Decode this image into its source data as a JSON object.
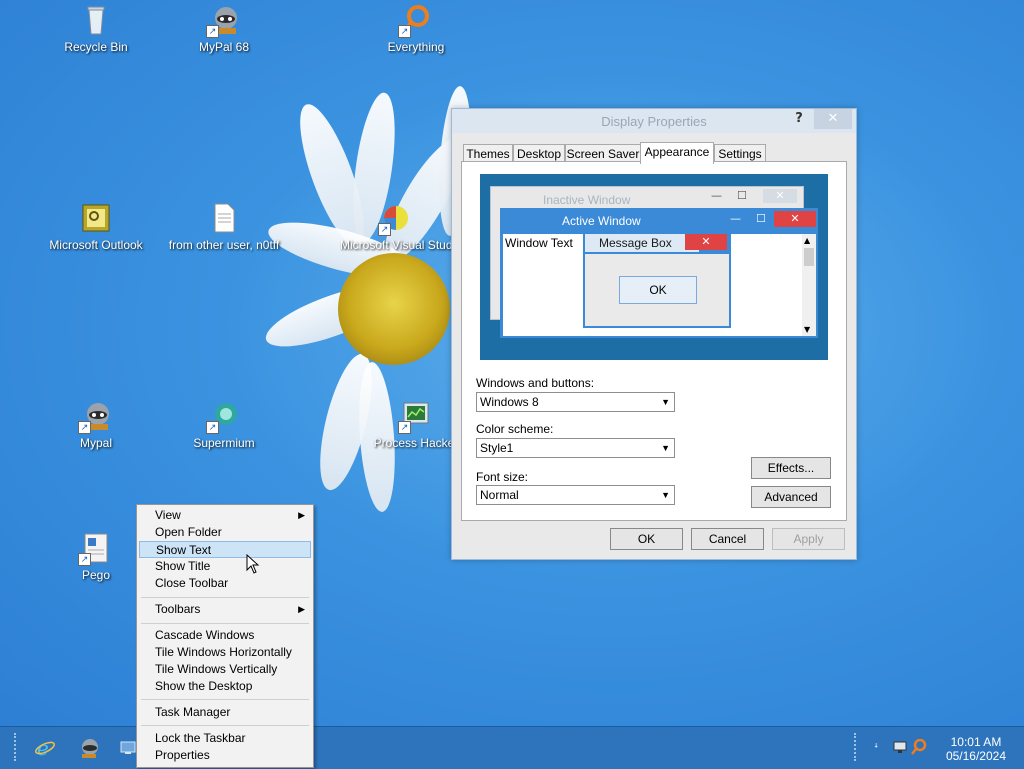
{
  "desktop": {
    "icons": [
      {
        "label": "Recycle Bin"
      },
      {
        "label": "MyPal 68"
      },
      {
        "label": "Everything"
      },
      {
        "label": "Microsoft Outlook"
      },
      {
        "label": "from other user, n0tff"
      },
      {
        "label": "Microsoft Visual Stud"
      },
      {
        "label": "Mypal"
      },
      {
        "label": "Supermium"
      },
      {
        "label": "Process Hacker"
      },
      {
        "label": "Pego"
      }
    ]
  },
  "dialog": {
    "title": "Display Properties",
    "help_label": "?",
    "close_label": "✕",
    "tabs": [
      {
        "label": "Themes"
      },
      {
        "label": "Desktop"
      },
      {
        "label": "Screen Saver"
      },
      {
        "label": "Appearance"
      },
      {
        "label": "Settings"
      }
    ],
    "preview": {
      "inactive_title": "Inactive Window",
      "active_title": "Active Window",
      "window_text": "Window Text",
      "message_title": "Message Box",
      "ok_label": "OK"
    },
    "windows_buttons": {
      "label": "Windows and buttons:",
      "value": "Windows 8"
    },
    "color_scheme": {
      "label": "Color scheme:",
      "value": "Style1"
    },
    "font_size": {
      "label": "Font size:",
      "value": "Normal"
    },
    "effects_label": "Effects...",
    "advanced_label": "Advanced",
    "ok_label": "OK",
    "cancel_label": "Cancel",
    "apply_label": "Apply"
  },
  "context_menu": {
    "items": [
      {
        "label": "View"
      },
      {
        "label": "Open Folder"
      },
      {
        "label": "Show Text"
      },
      {
        "label": "Show Title"
      },
      {
        "label": "Close Toolbar"
      },
      {
        "label": "Toolbars"
      },
      {
        "label": "Cascade Windows"
      },
      {
        "label": "Tile Windows Horizontally"
      },
      {
        "label": "Tile Windows Vertically"
      },
      {
        "label": "Show the Desktop"
      },
      {
        "label": "Task Manager"
      },
      {
        "label": "Lock the Taskbar"
      },
      {
        "label": "Properties"
      }
    ]
  },
  "taskbar": {
    "time": "10:01 AM",
    "date": "05/16/2024"
  },
  "colors": {
    "desktop_bg": "#3b93e0",
    "taskbar_bg": "#2d74bd",
    "active_caption": "#3a8ad8",
    "close_red": "#e04343"
  }
}
